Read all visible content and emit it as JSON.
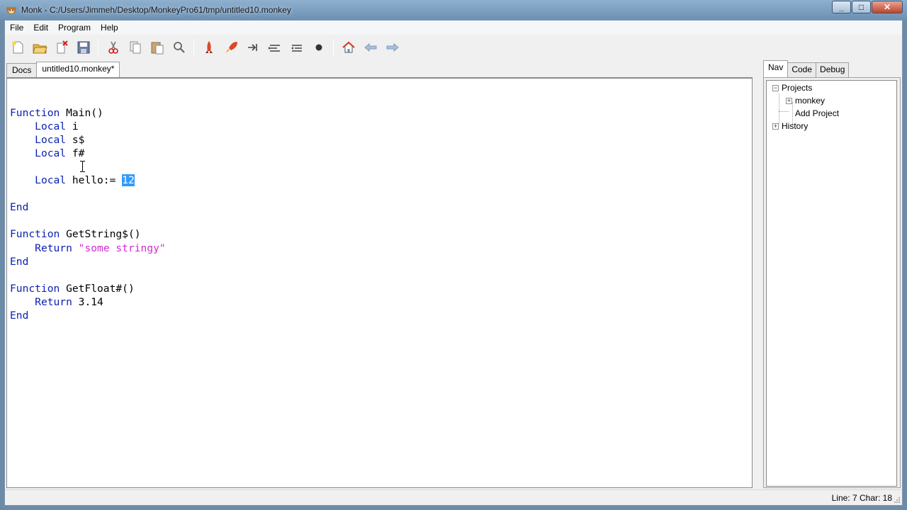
{
  "window": {
    "title": "Monk - C:/Users/Jimmeh/Desktop/MonkeyPro61/tmp/untitled10.monkey",
    "minimize_icon": "minimize-icon",
    "maximize_icon": "maximize-icon",
    "close_icon": "close-icon"
  },
  "menu": {
    "items": [
      "File",
      "Edit",
      "Program",
      "Help"
    ]
  },
  "toolbar": {
    "buttons": [
      {
        "name": "new-file",
        "icon": "new-file-icon"
      },
      {
        "name": "open-file",
        "icon": "open-folder-icon"
      },
      {
        "name": "close-file",
        "icon": "close-file-icon"
      },
      {
        "name": "save-file",
        "icon": "save-icon"
      },
      {
        "name": "cut",
        "icon": "scissors-icon"
      },
      {
        "name": "copy",
        "icon": "copy-icon"
      },
      {
        "name": "paste",
        "icon": "paste-icon"
      },
      {
        "name": "find",
        "icon": "magnifier-icon"
      },
      {
        "name": "build",
        "icon": "rocket-icon"
      },
      {
        "name": "build-run",
        "icon": "rocket-launch-icon"
      },
      {
        "name": "step",
        "icon": "step-icon"
      },
      {
        "name": "step-in",
        "icon": "step-in-icon"
      },
      {
        "name": "step-out",
        "icon": "step-out-icon"
      },
      {
        "name": "stop",
        "icon": "stop-dot-icon"
      },
      {
        "name": "home",
        "icon": "home-icon"
      },
      {
        "name": "back",
        "icon": "back-arrow-icon"
      },
      {
        "name": "forward",
        "icon": "forward-arrow-icon"
      }
    ]
  },
  "doc_tabs": {
    "docs": "Docs",
    "file": "untitled10.monkey*"
  },
  "editor": {
    "lines": [
      [],
      [
        {
          "t": "Function",
          "c": "kw"
        },
        {
          "t": " Main()"
        }
      ],
      [
        {
          "t": "    "
        },
        {
          "t": "Local",
          "c": "kw"
        },
        {
          "t": " i"
        }
      ],
      [
        {
          "t": "    "
        },
        {
          "t": "Local",
          "c": "kw"
        },
        {
          "t": " s$"
        }
      ],
      [
        {
          "t": "    "
        },
        {
          "t": "Local",
          "c": "kw"
        },
        {
          "t": " f#"
        }
      ],
      [],
      [
        {
          "t": "    "
        },
        {
          "t": "Local",
          "c": "kw"
        },
        {
          "t": " hello:= "
        },
        {
          "t": "12",
          "c": "sel"
        }
      ],
      [],
      [
        {
          "t": "End",
          "c": "kw"
        }
      ],
      [],
      [
        {
          "t": "Function",
          "c": "kw"
        },
        {
          "t": " GetString$()"
        }
      ],
      [
        {
          "t": "    "
        },
        {
          "t": "Return",
          "c": "kw"
        },
        {
          "t": " "
        },
        {
          "t": "\"some stringy\"",
          "c": "str"
        }
      ],
      [
        {
          "t": "End",
          "c": "kw"
        }
      ],
      [],
      [
        {
          "t": "Function",
          "c": "kw"
        },
        {
          "t": " GetFloat#()"
        }
      ],
      [
        {
          "t": "    "
        },
        {
          "t": "Return",
          "c": "kw"
        },
        {
          "t": " 3.14"
        }
      ],
      [
        {
          "t": "End",
          "c": "kw"
        }
      ]
    ]
  },
  "side_tabs": {
    "nav": "Nav",
    "code": "Code",
    "debug": "Debug"
  },
  "tree": {
    "projects": "Projects",
    "monkey": "monkey",
    "add_project": "Add Project",
    "history": "History"
  },
  "status": {
    "text": "Line: 7 Char: 18"
  }
}
